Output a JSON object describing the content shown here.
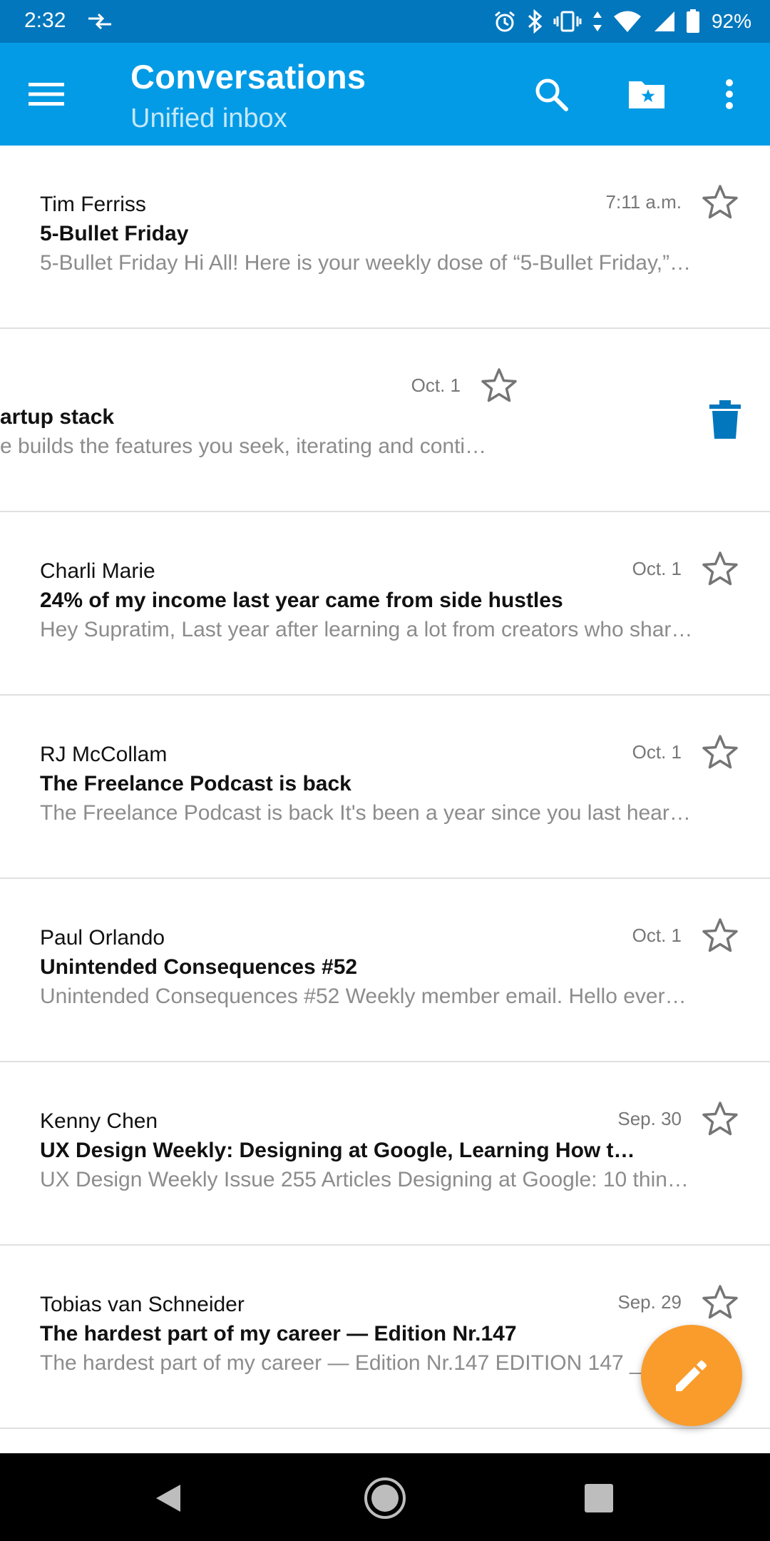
{
  "status_bar": {
    "time": "2:32",
    "battery": "92%"
  },
  "app_bar": {
    "title": "Conversations",
    "subtitle": "Unified inbox",
    "colors": {
      "status_bar": "#0277bd",
      "app_bar": "#039be5",
      "fab": "#f99c2c"
    }
  },
  "emails": [
    {
      "sender": "Tim Ferriss",
      "subject": "5-Bullet Friday",
      "snippet": "5-Bullet Friday Hi All! Here is your weekly dose of “5-Bullet Friday,” a l…",
      "date": "7:11 a.m."
    },
    {
      "sender": "",
      "subject": "artup stack",
      "snippet": "e builds the features you seek, iterating and conti…",
      "date": "Oct. 1",
      "swiped": true
    },
    {
      "sender": "Charli Marie",
      "subject": "24% of my income last year came from side hustles",
      "snippet": "Hey Supratim, Last year after learning a lot from creators who share…",
      "date": "Oct. 1"
    },
    {
      "sender": "RJ McCollam",
      "subject": "The Freelance Podcast is back",
      "snippet": "The Freelance Podcast is back It's been a year since you last heard f…",
      "date": "Oct. 1"
    },
    {
      "sender": "Paul Orlando",
      "subject": "Unintended Consequences #52",
      "snippet": "Unintended Consequences #52 Weekly member email. Hello everyo…",
      "date": "Oct. 1"
    },
    {
      "sender": "Kenny Chen",
      "subject": "UX Design Weekly: Designing at Google, Learning How t…",
      "snippet": "UX Design Weekly Issue 255 Articles Designing at Google: 10 things…",
      "date": "Sep. 30"
    },
    {
      "sender": "Tobias van Schneider",
      "subject": "The hardest part of my career — Edition Nr.147",
      "snippet": "The hardest part of my career — Edition Nr.147 EDITION 147 _ Hi…",
      "date": "Sep. 29"
    }
  ]
}
